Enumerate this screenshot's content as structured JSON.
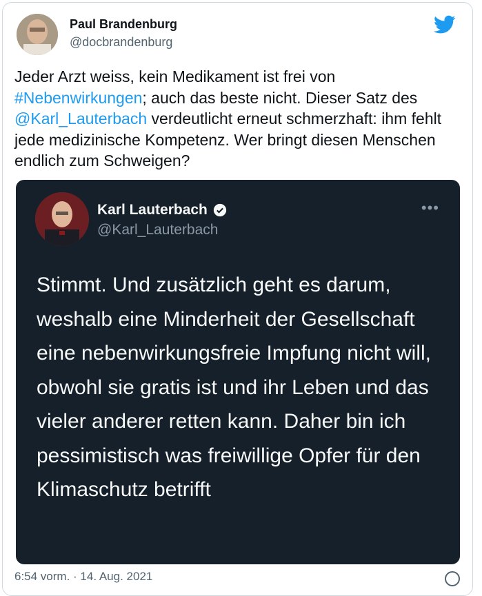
{
  "author": {
    "name": "Paul Brandenburg",
    "handle": "@docbrandenburg"
  },
  "tweet": {
    "text_1": "Jeder Arzt weiss, kein Medikament ist frei von",
    "hashtag": "#Nebenwirkungen",
    "text_2": "; auch das beste nicht. Dieser Satz des",
    "mention": "@Karl_Lauterbach",
    "text_3": " verdeutlicht erneut schmerzhaft: ihm fehlt jede medizinische Kompetenz. Wer bringt diesen Menschen endlich zum Schweigen?"
  },
  "embedded": {
    "name": "Karl Lauterbach",
    "handle": "@Karl_Lauterbach",
    "more_label": "•••",
    "text": "Stimmt. Und zusätzlich geht es darum, weshalb eine Minderheit der Gesellschaft eine nebenwirkungsfreie Impfung nicht will, obwohl sie gratis ist und ihr Leben und das vieler anderer retten kann. Daher bin ich pessimistisch was freiwillige Opfer für den Klimaschutz betrifft"
  },
  "timestamp": "6:54 vorm. · 14. Aug. 2021",
  "icons": {
    "brand": "twitter-bird-icon",
    "verified": "verified-badge-icon",
    "more": "more-dots-icon",
    "info": "info-icon"
  },
  "colors": {
    "link": "#1d9bf0",
    "embed_bg": "#15202b"
  }
}
